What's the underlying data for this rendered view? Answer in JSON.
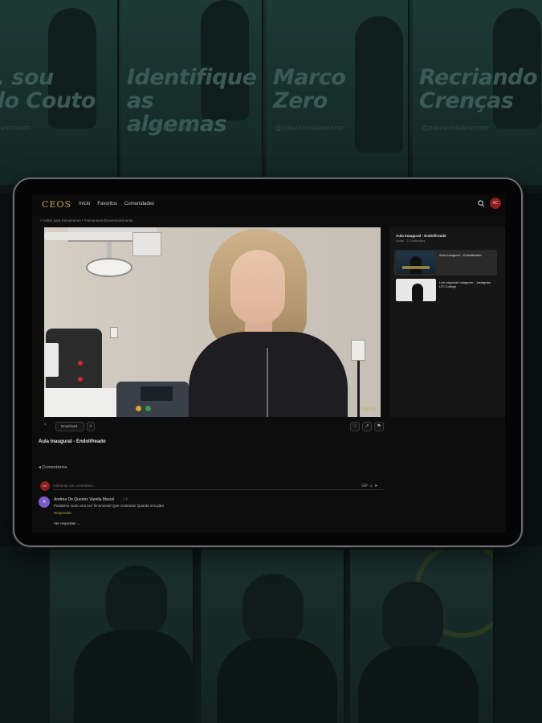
{
  "background": {
    "posters": [
      {
        "kicker": "",
        "title": "a, sou\nulo Couto",
        "handle": "@paulocouto"
      },
      {
        "kicker": "",
        "title": "Identifique\nas algemas",
        "handle": "@pauloroadmentor"
      },
      {
        "kicker": "",
        "title": "Marco\nZero",
        "handle": "@paulocoadmentor"
      },
      {
        "kicker": "",
        "title": "Recriando\nCrenças",
        "handle": "@pauloroadmentor"
      }
    ]
  },
  "app": {
    "logo": "CEOS",
    "nav": [
      "Início",
      "Favoritos",
      "Comunidades"
    ],
    "user_initials": "AC",
    "breadcrumb": "< Voltar para treinamento  •  Treinamento/Desenvolvimento"
  },
  "video": {
    "watermark": "CEOS",
    "title": "Aula Inaugural - Endolifreado",
    "download_label": "Download",
    "prev_label": "<",
    "next_label": ">",
    "icons": [
      "heart-icon",
      "share-icon",
      "bookmark-icon"
    ]
  },
  "comments": {
    "label": "Comentários",
    "input_placeholder": "Adicionar um comentário...",
    "items": [
      {
        "initials": "A",
        "author": "Andrea De Queiroz Varella Maciel",
        "time": "1 h",
        "text": "Parabéns mais uma vez fenomenal! Que conteúdo! Quanta emoção!",
        "reply_label": "Responder"
      }
    ],
    "more_label": "Ver respostas ⌄"
  },
  "playlist": {
    "title": "Aula Inaugural - Endolifreado",
    "subtitle": "Aulas · 2 Conteúdos",
    "items": [
      {
        "label": "Aula Inaugural – Endolifreado",
        "active": true
      },
      {
        "label": "Live especial Instagram – Instagram UTI College",
        "active": false
      }
    ]
  },
  "colors": {
    "accent": "#c9a24a",
    "avatar": "#8a1f1f",
    "commenter_avatar": "#7a5ac9"
  }
}
